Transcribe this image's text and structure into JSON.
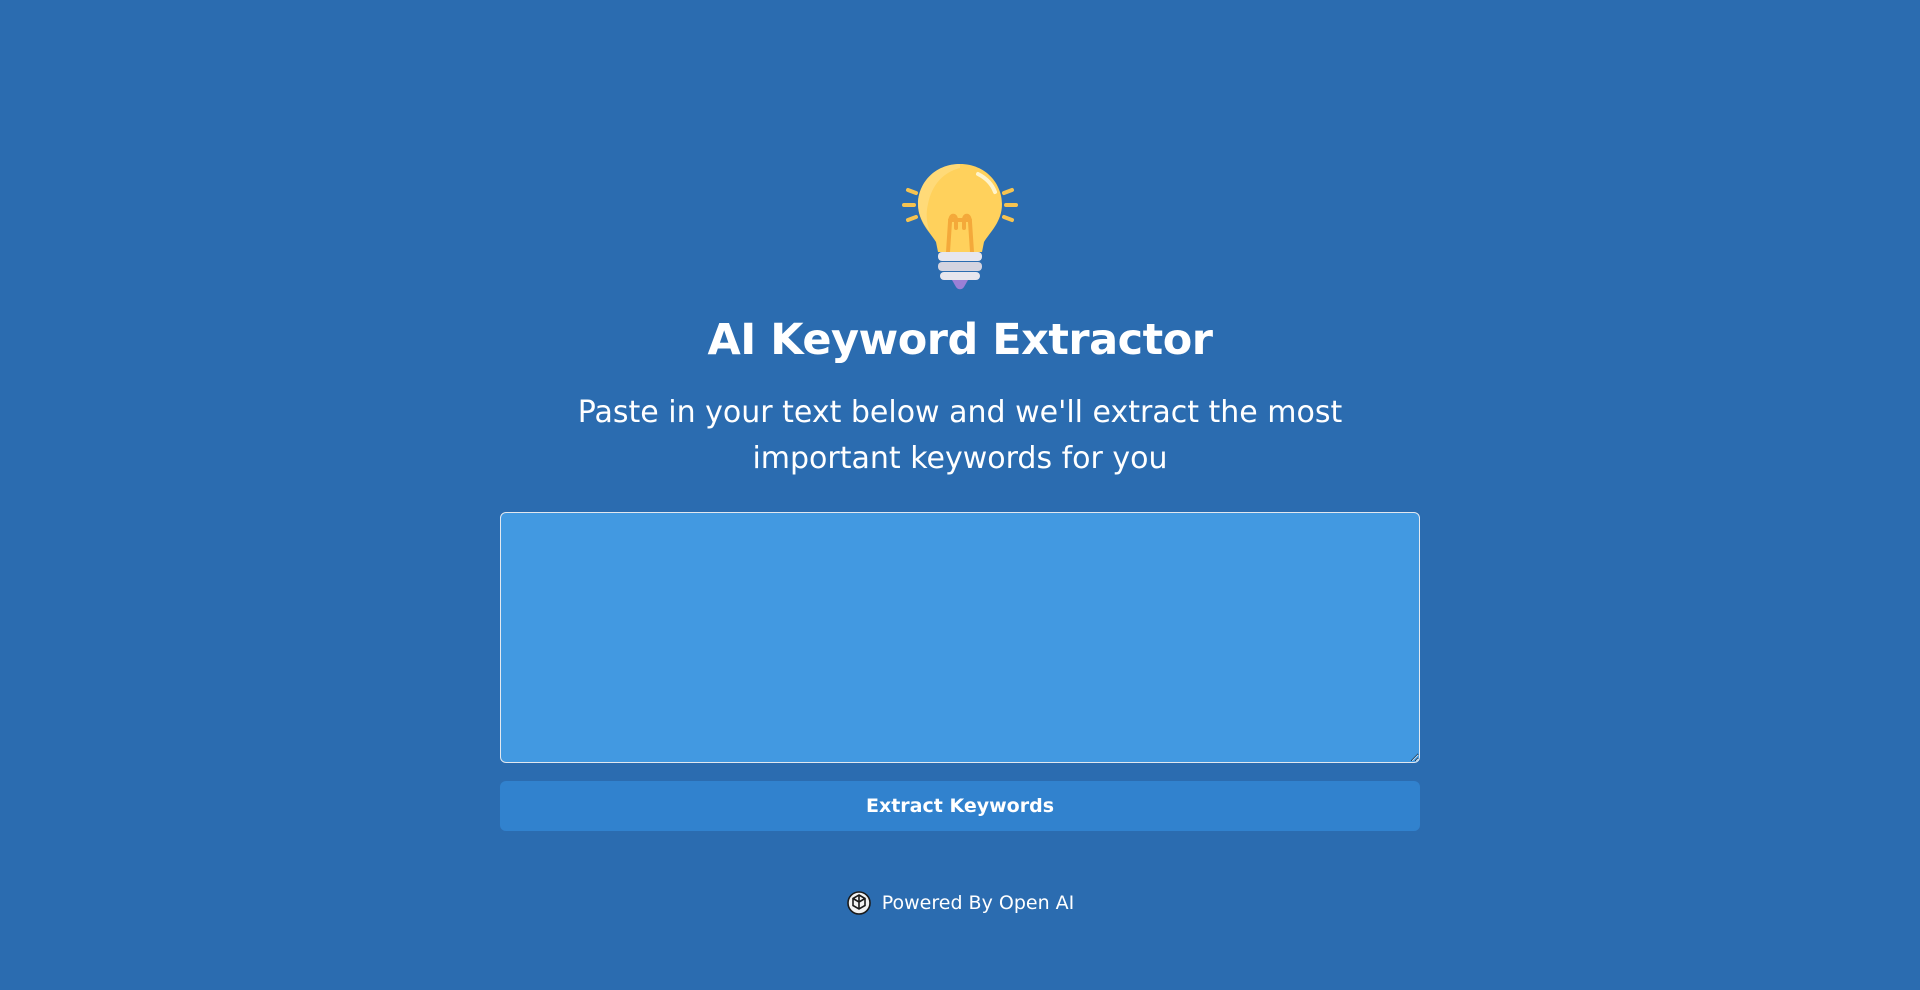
{
  "header": {
    "logo_icon": "lightbulb-icon",
    "title": "AI Keyword Extractor",
    "subtitle": "Paste in your text below and we'll extract the most important keywords for you"
  },
  "form": {
    "textarea_value": "",
    "textarea_placeholder": "",
    "submit_label": "Extract Keywords"
  },
  "footer": {
    "icon": "openai-icon",
    "text": "Powered By Open AI"
  },
  "colors": {
    "background": "#2b6cb0",
    "textarea_bg": "#4299e1",
    "button_bg": "#3182ce",
    "bulb": "#ffd15c"
  }
}
